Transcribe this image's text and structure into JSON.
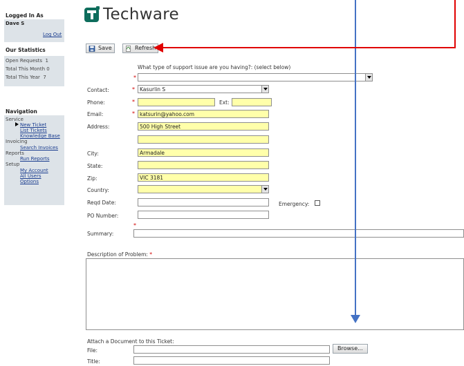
{
  "sidebar": {
    "logged_in_title": "Logged In As",
    "user_name": "Dave S",
    "logout_label": "Log Out",
    "stats_title": "Our Statistics",
    "stats": [
      {
        "label": "Open Requests",
        "value": "1"
      },
      {
        "label": "Total This Month",
        "value": "0"
      },
      {
        "label": "Total This Year",
        "value": "7"
      }
    ],
    "nav_title": "Navigation",
    "nav": {
      "service_label": "Service",
      "new_ticket": "New Ticket",
      "list_tickets": "List Tickets",
      "knowledge_base": "Knowledge Base",
      "invoicing_label": "Invoicing",
      "search_invoices": "Search Invoices",
      "reports_label": "Reports",
      "run_reports": "Run Reports",
      "setup_label": "Setup",
      "my_account": "My Account",
      "all_users": "All Users",
      "options": "Options"
    }
  },
  "header": {
    "logo_text": "Techware",
    "logo_icon": "techware-t-logo-icon"
  },
  "toolbar": {
    "save_label": "Save",
    "refresh_label": "Refresh",
    "save_icon": "floppy-disk-icon",
    "refresh_icon": "refresh-page-icon"
  },
  "form": {
    "issue_prompt": "What type of support issue are you having?: (select below)",
    "issue_type_value": "",
    "required_mark": "*",
    "contact_label": "Contact:",
    "contact_value": "Kasurlin S",
    "phone_label": "Phone:",
    "phone_value": "",
    "ext_label": "Ext:",
    "ext_value": "",
    "email_label": "Email:",
    "email_value": "katsurin@yahoo.com",
    "address_label": "Address:",
    "address_line1": "500 High Street",
    "address_line2": "",
    "city_label": "City:",
    "city_value": "Armadale",
    "state_label": "State:",
    "state_value": "",
    "zip_label": "Zip:",
    "zip_value": "VIC 3181",
    "country_label": "Country:",
    "country_value": "",
    "reqd_date_label": "Reqd Date:",
    "reqd_date_value": "",
    "emergency_label": "Emergency:",
    "emergency_checked": false,
    "po_label": "PO Number:",
    "po_value": "",
    "summary_label": "Summary:",
    "summary_value": "",
    "description_label": "Description of Problem:",
    "description_value": "",
    "attach_title": "Attach a Document to this Ticket:",
    "file_label": "File:",
    "file_value": "",
    "browse_label": "Browse...",
    "title_label": "Title:",
    "title_value": ""
  },
  "annotations": {
    "blue_arrow_color": "#4472c4",
    "red_arrow_color": "#e00000"
  }
}
